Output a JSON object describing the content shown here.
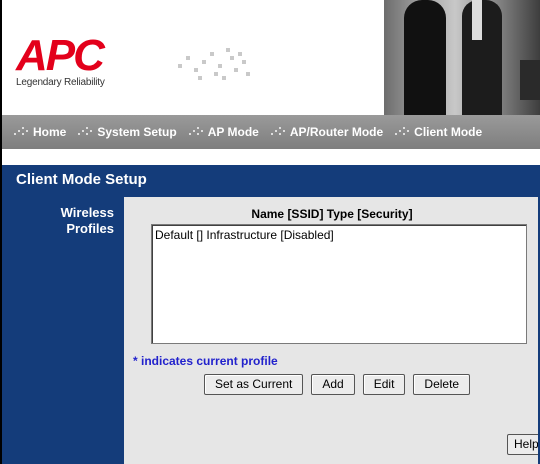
{
  "header": {
    "logo_text": "APC",
    "tagline": "Legendary Reliability"
  },
  "nav": {
    "items": [
      {
        "label": "Home"
      },
      {
        "label": "System Setup"
      },
      {
        "label": "AP Mode"
      },
      {
        "label": "AP/Router Mode"
      },
      {
        "label": "Client Mode"
      }
    ]
  },
  "page": {
    "title": "Client Mode Setup"
  },
  "sidebar": {
    "line1": "Wireless",
    "line2": "Profiles"
  },
  "profiles": {
    "column_header": "Name [SSID] Type [Security]",
    "items": [
      "Default [] Infrastructure [Disabled]"
    ],
    "note": "* indicates current profile"
  },
  "buttons": {
    "set_current": "Set as Current",
    "add": "Add",
    "edit": "Edit",
    "delete": "Delete",
    "help": "Help"
  },
  "colors": {
    "brand_red": "#e3001b",
    "navy": "#143c7a",
    "nav_gray": "#8c8c8c",
    "note_blue": "#2222cc"
  }
}
